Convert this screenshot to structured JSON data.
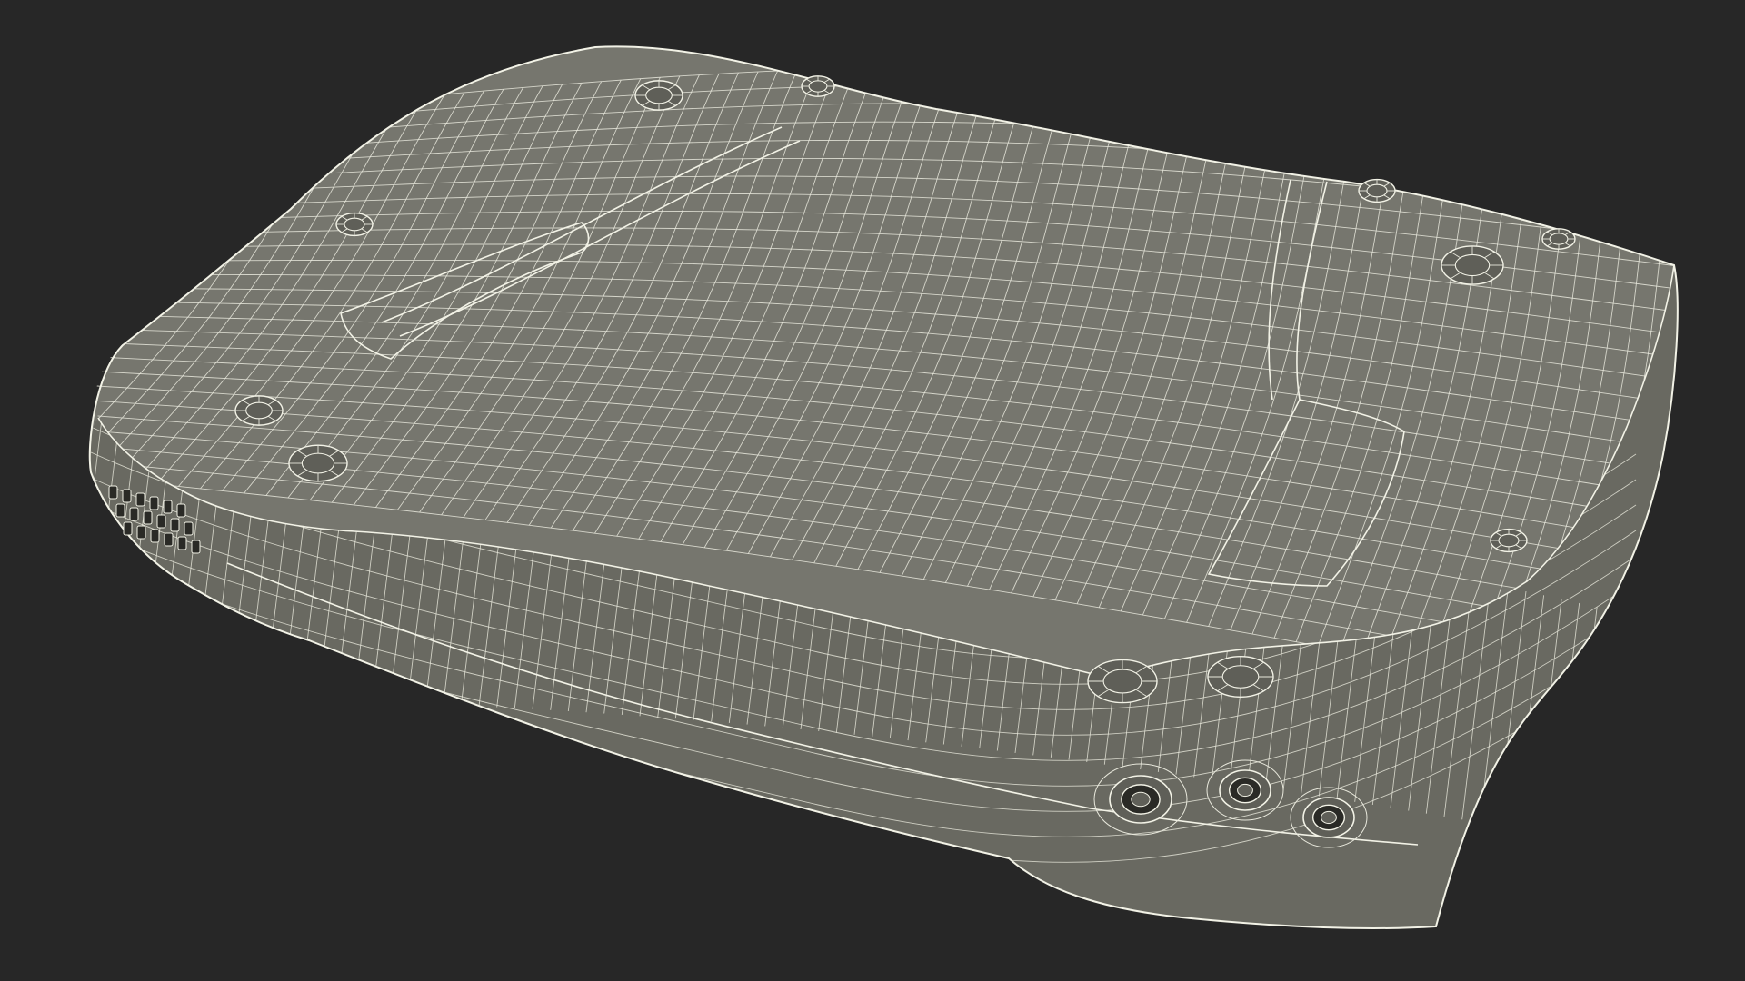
{
  "scene": {
    "background_color": "#272727",
    "model": {
      "subject": "wireframe-device-model",
      "surface_color": "#76766e",
      "surface_shadow_color": "#5f5f58",
      "wire_color": "#e8e8dc",
      "wire_strong_color": "#f2f2e6",
      "port_dark_color": "#2a2a26"
    }
  }
}
